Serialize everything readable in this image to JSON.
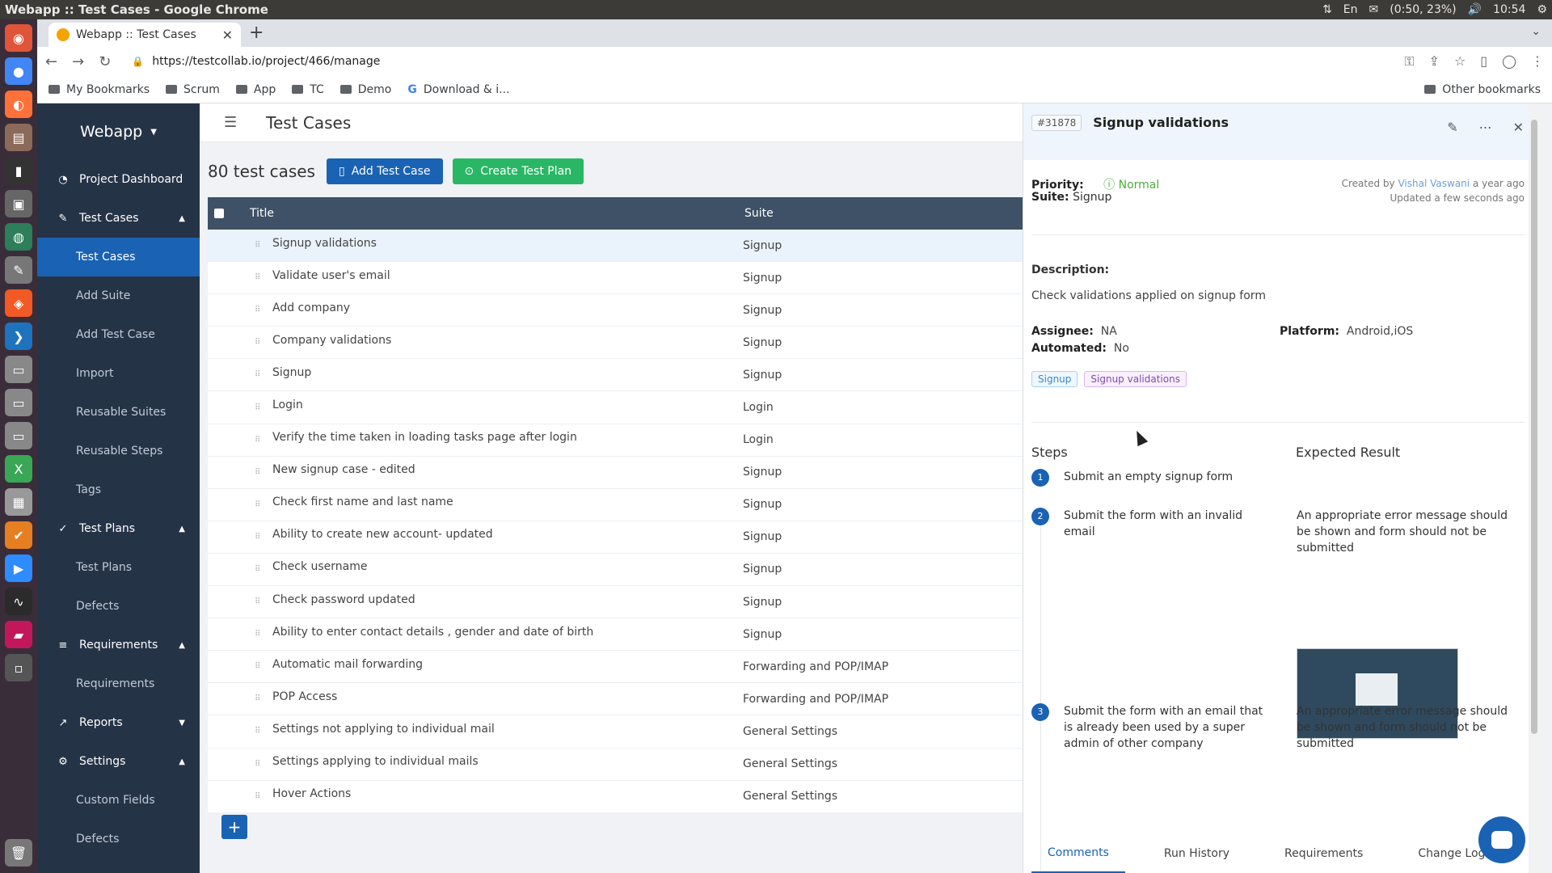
{
  "os": {
    "window_title": "Webapp :: Test Cases - Google Chrome",
    "lang": "En",
    "battery": "(0:50, 23%)",
    "clock": "10:54"
  },
  "browser": {
    "tab_title": "Webapp :: Test Cases",
    "url": "https://testcollab.io/project/466/manage",
    "bookmarks": [
      "My Bookmarks",
      "Scrum",
      "App",
      "TC",
      "Demo",
      "Download & i..."
    ],
    "other_bookmarks": "Other bookmarks"
  },
  "sidebar": {
    "brand": "Webapp",
    "items": [
      {
        "label": "Project Dashboard",
        "type": "section",
        "icon": "dashboard-icon"
      },
      {
        "label": "Test Cases",
        "type": "section",
        "icon": "edit-icon",
        "caret": "▲"
      },
      {
        "label": "Test Cases",
        "type": "sub",
        "active": true
      },
      {
        "label": "Add Suite",
        "type": "sub"
      },
      {
        "label": "Add Test Case",
        "type": "sub"
      },
      {
        "label": "Import",
        "type": "sub"
      },
      {
        "label": "Reusable Suites",
        "type": "sub"
      },
      {
        "label": "Reusable Steps",
        "type": "sub"
      },
      {
        "label": "Tags",
        "type": "sub"
      },
      {
        "label": "Test Plans",
        "type": "section",
        "icon": "check-circle-icon",
        "caret": "▲"
      },
      {
        "label": "Test Plans",
        "type": "sub"
      },
      {
        "label": "Defects",
        "type": "sub"
      },
      {
        "label": "Requirements",
        "type": "section",
        "icon": "list-icon",
        "caret": "▲"
      },
      {
        "label": "Requirements",
        "type": "sub"
      },
      {
        "label": "Reports",
        "type": "section",
        "icon": "chart-icon",
        "caret": "▼"
      },
      {
        "label": "Settings",
        "type": "section",
        "icon": "gear-icon",
        "caret": "▲"
      },
      {
        "label": "Custom Fields",
        "type": "sub"
      },
      {
        "label": "Defects",
        "type": "sub"
      }
    ]
  },
  "main": {
    "page_title": "Test Cases",
    "count_label": "80 test cases",
    "add_test_case": "Add Test Case",
    "create_test_plan": "Create Test Plan",
    "columns": {
      "title": "Title",
      "suite": "Suite"
    },
    "rows": [
      {
        "title": "Signup validations",
        "suite": "Signup",
        "selected": true
      },
      {
        "title": "Validate user's email",
        "suite": "Signup"
      },
      {
        "title": "Add company",
        "suite": "Signup"
      },
      {
        "title": "Company validations",
        "suite": "Signup"
      },
      {
        "title": "Signup",
        "suite": "Signup"
      },
      {
        "title": "Login",
        "suite": "Login"
      },
      {
        "title": "Verify the time taken in loading tasks page after login",
        "suite": "Login"
      },
      {
        "title": "New signup case - edited",
        "suite": "Signup"
      },
      {
        "title": "Check first name and last name",
        "suite": "Signup"
      },
      {
        "title": "Ability to create new account- updated",
        "suite": "Signup"
      },
      {
        "title": "Check username",
        "suite": "Signup"
      },
      {
        "title": "Check password updated",
        "suite": "Signup"
      },
      {
        "title": "Ability to enter contact details , gender and date of birth",
        "suite": "Signup"
      },
      {
        "title": "Automatic mail forwarding",
        "suite": "Forwarding and POP/IMAP"
      },
      {
        "title": "POP Access",
        "suite": "Forwarding and POP/IMAP"
      },
      {
        "title": "Settings not applying to individual mail",
        "suite": "General Settings"
      },
      {
        "title": "Settings applying to individual mails",
        "suite": "General Settings"
      },
      {
        "title": "Hover Actions",
        "suite": "General Settings"
      }
    ]
  },
  "panel": {
    "id_badge": "#31878",
    "title": "Signup validations",
    "priority_label": "Priority:",
    "priority_value": "Normal",
    "suite_label": "Suite:",
    "suite_value": "Signup",
    "created_prefix": "Created by",
    "created_user": "Vishal Vaswani",
    "created_when": "a year ago",
    "updated": "Updated a few seconds ago",
    "description_label": "Description:",
    "description": "Check validations applied on signup form",
    "assignee_label": "Assignee:",
    "assignee": "NA",
    "automated_label": "Automated:",
    "automated": "No",
    "platform_label": "Platform:",
    "platform": "Android,iOS",
    "tags": [
      "Signup",
      "Signup validations"
    ],
    "steps_label": "Steps",
    "expected_label": "Expected Result",
    "steps": [
      {
        "num": "1",
        "step": "Submit an empty signup form",
        "expected": ""
      },
      {
        "num": "2",
        "step": "Submit the form with an invalid email",
        "expected": "An appropriate error message should be shown and form should not be submitted"
      },
      {
        "num": "3",
        "step": "Submit the form with an email that is already been used by a super admin of other company",
        "expected": "An appropriate error message should be shown and form should not be submitted"
      }
    ],
    "tabs": [
      "Comments",
      "Run History",
      "Requirements",
      "Change Log"
    ],
    "active_tab": "Comments"
  }
}
